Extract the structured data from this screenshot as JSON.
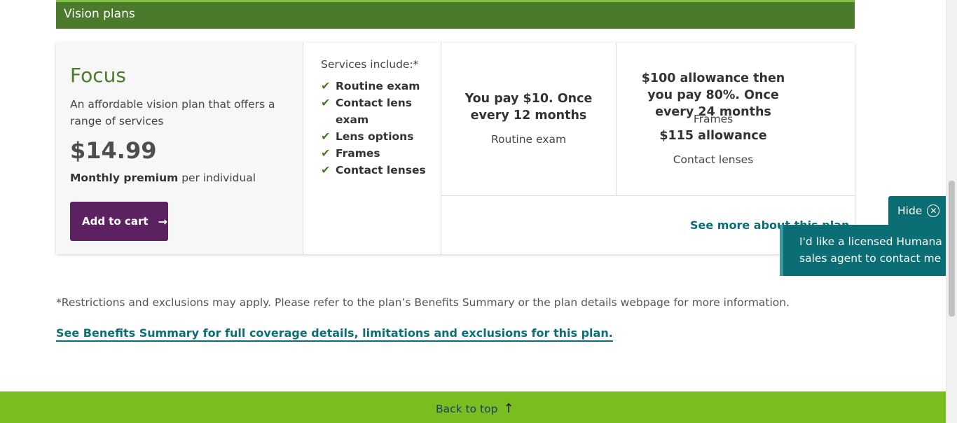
{
  "section": {
    "title": "Vision plans"
  },
  "plan": {
    "name": "Focus",
    "description": "An affordable vision plan that offers a range of services",
    "price": "$14.99",
    "premium_bold": "Monthly premium",
    "premium_rest": "per individual",
    "add_to_cart": "Add to cart"
  },
  "services": {
    "title": "Services include:*",
    "items": [
      "Routine exam",
      "Contact lens exam",
      "Lens options",
      "Frames",
      "Contact lenses"
    ]
  },
  "costs": {
    "routine_exam_cost": "You pay $10. Once every 12 months",
    "routine_exam_label": "Routine exam",
    "frames_cost": "$100 allowance then you pay 80%. Once every 24 months",
    "frames_label": "Frames",
    "contacts_cost": "$115 allowance",
    "contacts_label": "Contact lenses"
  },
  "see_more": "See more about this plan",
  "footnote": "*Restrictions and exclusions may apply. Please refer to the plan’s Benefits Summary or the plan details webpage for more information.",
  "benefits_link": "See Benefits Summary for full coverage details, limitations and exclusions for this plan.",
  "back_to_top": "Back to top",
  "widget": {
    "hide_label": "Hide",
    "agent_label": "I'd like a licensed Humana sales agent to contact me"
  },
  "colors": {
    "header_green": "#4b7a2c",
    "footer_green": "#78be20",
    "cart_purple": "#5c2160",
    "teal": "#0b6e74"
  },
  "icons": {
    "check": "check-icon",
    "arrow_right": "arrow-right-icon",
    "arrow_up": "arrow-up-icon",
    "close_circle": "close-circle-icon"
  }
}
